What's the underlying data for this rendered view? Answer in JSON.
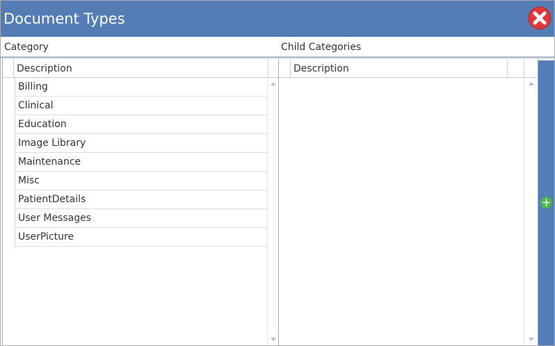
{
  "window": {
    "title": "Document Types"
  },
  "labels": {
    "category": "Category",
    "child_categories": "Child Categories"
  },
  "category_grid": {
    "header": "Description",
    "rows": [
      "Billing",
      "Clinical",
      "Education",
      "Image Library",
      "Maintenance",
      "Misc",
      "PatientDetails",
      "User Messages",
      "UserPicture"
    ]
  },
  "child_grid": {
    "header": "Description",
    "rows": []
  },
  "icons": {
    "close": "close-icon",
    "add": "add-icon",
    "scroll_up": "scroll-up-arrow-icon",
    "scroll_down": "scroll-down-arrow-icon"
  },
  "colors": {
    "title_bar": "#547db5",
    "close_red": "#e0383a",
    "add_green": "#4cb748"
  }
}
